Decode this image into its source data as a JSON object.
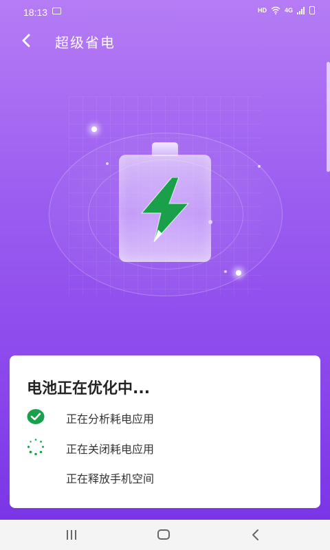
{
  "status_bar": {
    "time": "18:13",
    "hd_label": "HD",
    "network_label": "4G"
  },
  "header": {
    "title": "超级省电"
  },
  "colors": {
    "accent_green": "#1aa04a",
    "background_top": "#b57cf5",
    "background_bottom": "#7a35e6"
  },
  "card": {
    "title": "电池正在优化中...",
    "tasks": [
      {
        "label": "正在分析耗电应用",
        "status": "done",
        "icon": "check-circle-icon"
      },
      {
        "label": "正在关闭耗电应用",
        "status": "in-progress",
        "icon": "loading-spinner-icon"
      },
      {
        "label": "正在释放手机空间",
        "status": "pending",
        "icon": ""
      }
    ]
  }
}
